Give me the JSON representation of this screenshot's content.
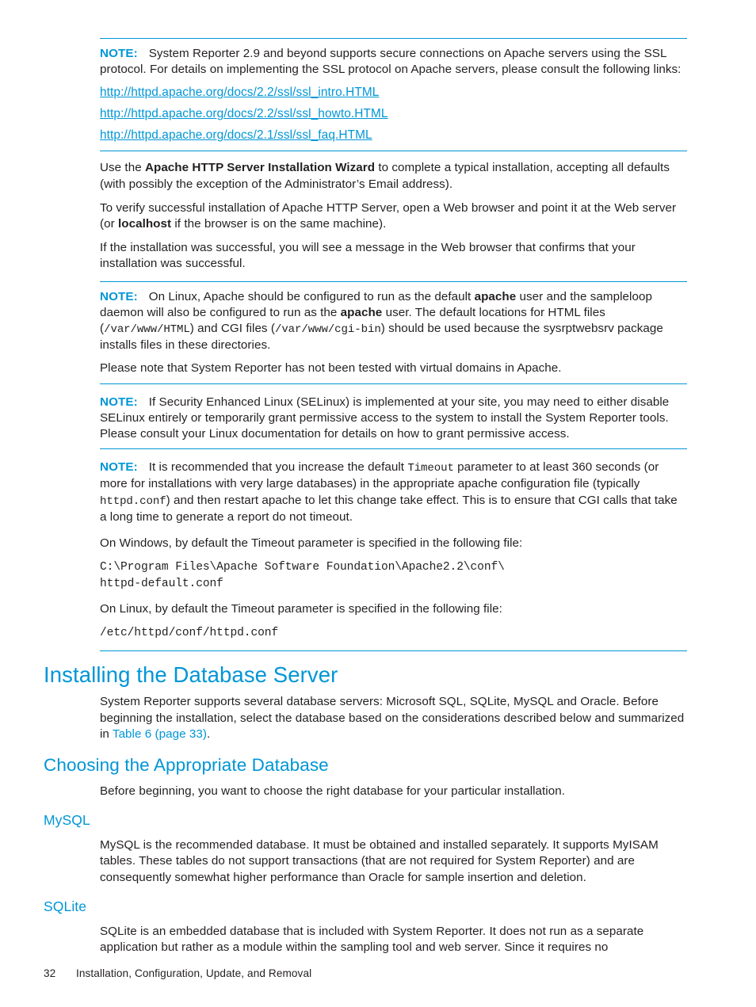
{
  "document": {
    "page_number": "32",
    "footer_chapter": "Installation, Configuration, Update, and Removal",
    "accent_color": "#0096d6",
    "text_color": "#231f20"
  },
  "note_label": "NOTE:",
  "notes": {
    "ssl": {
      "label": "NOTE:",
      "text": "System Reporter 2.9 and beyond supports secure connections on Apache servers using the SSL protocol. For details on implementing the SSL protocol on Apache servers, please consult the following links:",
      "links": [
        "http://httpd.apache.org/docs/2.2/ssl/ssl_intro.HTML",
        "http://httpd.apache.org/docs/2.2/ssl/ssl_howto.HTML",
        "http://httpd.apache.org/docs/2.1/ssl/ssl_faq.HTML"
      ]
    },
    "linux_apache": {
      "label": "NOTE:",
      "p1_a": "On Linux, Apache should be configured to run as the default ",
      "p1_b_bold": "apache",
      "p1_c": " user and the sampleloop daemon will also be configured to run as the ",
      "p1_d_bold": "apache",
      "p1_e": " user. The default locations for HTML files (",
      "p1_f_mono": "/var/www/HTML",
      "p1_g": ") and CGI files (",
      "p1_h_mono": "/var/www/cgi-bin",
      "p1_i": ") should be used because the sysrptwebsrv package installs files in these directories.",
      "p2": "Please note that System Reporter has not been tested with virtual domains in Apache."
    },
    "selinux": {
      "label": "NOTE:",
      "text": "If Security Enhanced Linux (SELinux) is implemented at your site, you may need to either disable SELinux entirely or temporarily grant permissive access to the system to install the System Reporter tools. Please consult your Linux documentation for details on how to grant permissive access."
    },
    "timeout": {
      "label": "NOTE:",
      "p_a": "It is recommended that you increase the default ",
      "p_b_mono": "Timeout",
      "p_c": " parameter to at least 360 seconds (or more for installations with very large databases) in the appropriate apache configuration file (typically ",
      "p_d_mono": "httpd.conf",
      "p_e": ") and then restart apache to let this change take effect. This is to ensure that CGI calls that take a long time to generate a report do not timeout."
    }
  },
  "apache_section": {
    "p_wizard_a": "Use the ",
    "p_wizard_bold": "Apache HTTP Server Installation Wizard",
    "p_wizard_b": " to complete a typical installation, accepting all defaults (with possibly the exception of the Administrator’s Email address).",
    "p_verify_a": "To verify successful installation of Apache HTTP Server, open a Web browser and point it at the Web server (or ",
    "p_verify_bold": "localhost",
    "p_verify_b": " if the browser is on the same machine).",
    "p_success": "If the installation was successful, you will see a message in the Web browser that confirms that your installation was successful."
  },
  "timeout_files": {
    "windows_intro": "On Windows, by default the Timeout parameter is specified in the following file:",
    "windows_path": "C:\\Program Files\\Apache Software Foundation\\Apache2.2\\conf\\\nhttpd-default.conf",
    "linux_intro": "On Linux, by default the Timeout parameter is specified in the following file:",
    "linux_path": "/etc/httpd/conf/httpd.conf"
  },
  "db_section": {
    "h1": "Installing the Database Server",
    "intro_a": "System Reporter supports several database servers: Microsoft SQL, SQLite, MySQL and Oracle. Before beginning the installation, select the database based on the considerations described below and summarized in ",
    "intro_link": "Table 6 (page 33)",
    "intro_b": ".",
    "h2_choosing": "Choosing the Appropriate Database",
    "choosing_text": "Before beginning, you want to choose the right database for your particular installation.",
    "h3_mysql": "MySQL",
    "mysql_text": "MySQL is the recommended database. It must be obtained and installed separately. It supports MyISAM tables. These tables do not support transactions (that are not required for System Reporter) and are consequently somewhat higher performance than Oracle for sample insertion and deletion.",
    "h3_sqlite": "SQLite",
    "sqlite_text": "SQLite is an embedded database that is included with System Reporter. It does not run as a separate application but rather as a module within the sampling tool and web server. Since it requires no"
  }
}
